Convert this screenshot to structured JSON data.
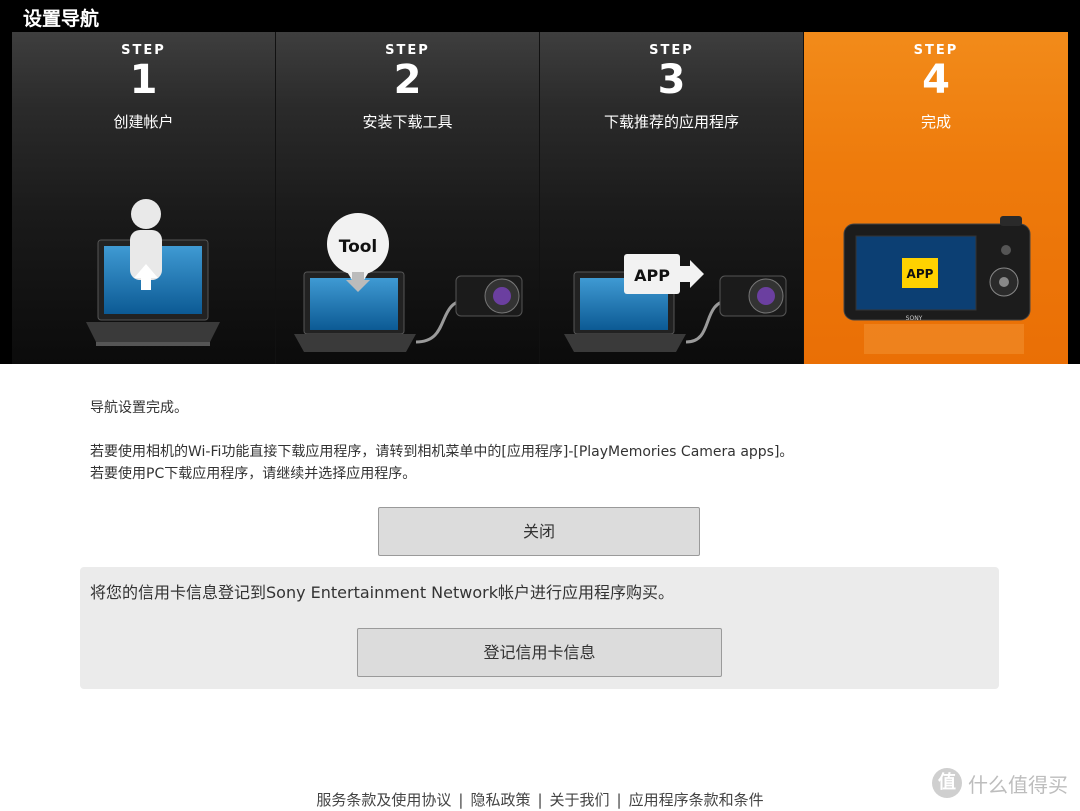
{
  "window": {
    "title": "设置导航"
  },
  "steps": [
    {
      "step_label": "STEP",
      "number": "1",
      "label": "创建帐户",
      "active": false
    },
    {
      "step_label": "STEP",
      "number": "2",
      "label": "安装下载工具",
      "active": false,
      "badge": "Tool"
    },
    {
      "step_label": "STEP",
      "number": "3",
      "label": "下载推荐的应用程序",
      "active": false,
      "badge": "APP"
    },
    {
      "step_label": "STEP",
      "number": "4",
      "label": "完成",
      "active": true,
      "badge": "APP",
      "brand": "SONY"
    }
  ],
  "main": {
    "line1": "导航设置完成。",
    "line2": "若要使用相机的Wi-Fi功能直接下载应用程序，请转到相机菜单中的[应用程序]-[PlayMemories Camera apps]。",
    "line3": "若要使用PC下载应用程序，请继续并选择应用程序。",
    "close_button": "关闭"
  },
  "card_panel": {
    "message": "将您的信用卡信息登记到Sony Entertainment Network帐户进行应用程序购买。",
    "register_button": "登记信用卡信息"
  },
  "footer": {
    "links": [
      "服务条款及使用协议",
      "隐私政策",
      "关于我们",
      "应用程序条款和条件"
    ],
    "separator": "|"
  },
  "watermark": {
    "logo": "值",
    "text": "什么值得买"
  },
  "colors": {
    "active_step": "#ee7b0c",
    "title_bar": "#000000",
    "badge_yellow": "#ffd200"
  }
}
